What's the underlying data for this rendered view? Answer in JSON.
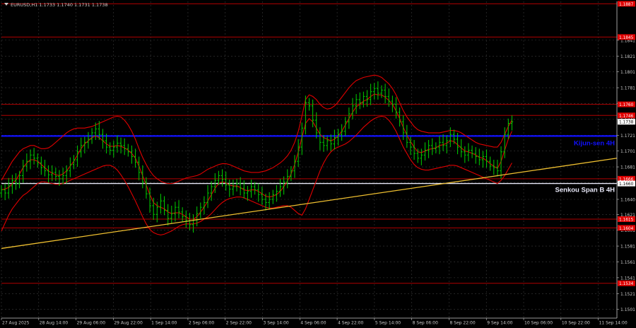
{
  "header": {
    "title": "EURUSD,H1  1.1733 1.1740 1.1731 1.1738"
  },
  "colors": {
    "background": "#000000",
    "grid": "#3a3a3a",
    "bull": "#00d000",
    "bear": "#00d000",
    "ichimoku": "#e00000",
    "kijun": "#1010ff",
    "senkou": "#e8e8f8",
    "level": "#b00000",
    "trend": "#f0c030",
    "axis_text": "#c8c8c8",
    "red_label_bg": "#e00000",
    "current_price_bg": "#ffffff"
  },
  "chart_data": {
    "type": "line",
    "symbol": "EURUSD",
    "timeframe": "H1",
    "ohlc_last": {
      "open": 1.1733,
      "high": 1.174,
      "low": 1.1731,
      "close": 1.1738
    },
    "ylim": [
      1.149,
      1.189
    ],
    "y_ticks": [
      "1.1841",
      "1.1821",
      "1.1801",
      "1.1781",
      "1.1761",
      "1.1741",
      "1.1721",
      "1.1701",
      "1.1681",
      "1.1661",
      "1.1640",
      "1.1621",
      "1.1601",
      "1.1581",
      "1.1561",
      "1.1541",
      "1.1521",
      "1.1501"
    ],
    "x_ticks": [
      "27 Aug 2025",
      "28 Aug 14:00",
      "29 Aug 06:00",
      "29 Aug 22:00",
      "1 Sep 14:00",
      "2 Sep 06:00",
      "2 Sep 22:00",
      "3 Sep 14:00",
      "4 Sep 06:00",
      "4 Sep 22:00",
      "5 Sep 14:00",
      "8 Sep 06:00",
      "8 Sep 22:00",
      "9 Sep 14:00",
      "10 Sep 06:00",
      "10 Sep 22:00",
      "11 Sep 14:00"
    ],
    "levels": [
      {
        "price": 1.1887,
        "label": "1.1887"
      },
      {
        "price": 1.1845,
        "label": "1.1845"
      },
      {
        "price": 1.176,
        "label": "1.1760"
      },
      {
        "price": 1.1746,
        "label": "1.1746"
      },
      {
        "price": 1.1666,
        "label": "1.1666"
      },
      {
        "price": 1.1615,
        "label": "1.1615"
      },
      {
        "price": 1.1604,
        "label": "1.1604"
      },
      {
        "price": 1.1534,
        "label": "1.1534"
      }
    ],
    "kijun_sen": {
      "price": 1.172,
      "label": "Kijun-sen 4H"
    },
    "senkou_span_b": {
      "price": 1.166,
      "label": "Senkou Span B 4H",
      "price_label": "1.1660"
    },
    "current_price": {
      "price": 1.1738,
      "label": "1.1738"
    },
    "trendline": {
      "start": [
        0,
        1.1578
      ],
      "end": [
        170,
        1.1692
      ]
    },
    "close": [
      1.1652,
      1.1648,
      1.1657,
      1.1664,
      1.166,
      1.167,
      1.1682,
      1.1688,
      1.1696,
      1.1692,
      1.1686,
      1.168,
      1.1676,
      1.1671,
      1.1674,
      1.1669,
      1.1666,
      1.167,
      1.1676,
      1.1684,
      1.169,
      1.17,
      1.1708,
      1.1712,
      1.1716,
      1.1724,
      1.1729,
      1.1722,
      1.1714,
      1.1706,
      1.1702,
      1.1706,
      1.1711,
      1.1708,
      1.1704,
      1.17,
      1.1694,
      1.1687,
      1.1674,
      1.1662,
      1.1647,
      1.1632,
      1.1621,
      1.163,
      1.1638,
      1.1626,
      1.1616,
      1.1622,
      1.163,
      1.1624,
      1.1618,
      1.1613,
      1.1608,
      1.1614,
      1.1622,
      1.163,
      1.1636,
      1.1648,
      1.1656,
      1.1664,
      1.167,
      1.1665,
      1.1658,
      1.1653,
      1.1656,
      1.166,
      1.1654,
      1.1648,
      1.165,
      1.1656,
      1.1652,
      1.1646,
      1.164,
      1.1636,
      1.164,
      1.1646,
      1.165,
      1.1656,
      1.1662,
      1.1669,
      1.1676,
      1.1688,
      1.1706,
      1.173,
      1.1762,
      1.1758,
      1.174,
      1.1724,
      1.1712,
      1.1708,
      1.1714,
      1.171,
      1.1718,
      1.1722,
      1.1726,
      1.1738,
      1.1748,
      1.1758,
      1.1766,
      1.1762,
      1.177,
      1.1766,
      1.1776,
      1.178,
      1.1774,
      1.1778,
      1.177,
      1.1764,
      1.176,
      1.175,
      1.1738,
      1.1724,
      1.1712,
      1.1706,
      1.1698,
      1.1692,
      1.1696,
      1.1702,
      1.1708,
      1.1704,
      1.1706,
      1.1712,
      1.1708,
      1.1714,
      1.1722,
      1.1716,
      1.1706,
      1.17,
      1.1696,
      1.1702,
      1.1698,
      1.1694,
      1.169,
      1.1694,
      1.1688,
      1.1682,
      1.168,
      1.1676,
      1.17,
      1.1722,
      1.1736,
      1.1738
    ],
    "tenkan": [
      1.1652,
      1.1653,
      1.1655,
      1.166,
      1.1664,
      1.1672,
      1.168,
      1.1686,
      1.169,
      1.169,
      1.1688,
      1.1684,
      1.168,
      1.1676,
      1.1673,
      1.1671,
      1.167,
      1.1672,
      1.1676,
      1.1682,
      1.1688,
      1.1696,
      1.1704,
      1.171,
      1.1714,
      1.1718,
      1.172,
      1.1718,
      1.1714,
      1.171,
      1.1707,
      1.1707,
      1.1708,
      1.1707,
      1.1705,
      1.1702,
      1.1698,
      1.1692,
      1.1682,
      1.167,
      1.1658,
      1.1646,
      1.1636,
      1.1632,
      1.163,
      1.1628,
      1.1624,
      1.1622,
      1.1623,
      1.1623,
      1.1621,
      1.1618,
      1.1615,
      1.1615,
      1.1618,
      1.1624,
      1.163,
      1.1638,
      1.1646,
      1.1654,
      1.166,
      1.1662,
      1.1661,
      1.1658,
      1.1657,
      1.1657,
      1.1655,
      1.1652,
      1.1651,
      1.1652,
      1.1652,
      1.165,
      1.1647,
      1.1644,
      1.1643,
      1.1644,
      1.1646,
      1.165,
      1.1656,
      1.1663,
      1.1672,
      1.1684,
      1.17,
      1.1718,
      1.1736,
      1.1742,
      1.1738,
      1.173,
      1.1722,
      1.1718,
      1.1716,
      1.1714,
      1.1716,
      1.172,
      1.1726,
      1.1734,
      1.1742,
      1.175,
      1.1757,
      1.176,
      1.1764,
      1.1766,
      1.177,
      1.1773,
      1.1772,
      1.1772,
      1.1769,
      1.1765,
      1.176,
      1.1752,
      1.1742,
      1.1731,
      1.1721,
      1.1713,
      1.1706,
      1.17,
      1.1699,
      1.1701,
      1.1703,
      1.1704,
      1.1705,
      1.1708,
      1.1709,
      1.1711,
      1.1714,
      1.1713,
      1.1709,
      1.1705,
      1.1701,
      1.17,
      1.1698,
      1.1696,
      1.1693,
      1.1692,
      1.1689,
      1.1685,
      1.1682,
      1.1679,
      1.1688,
      1.1702,
      1.1716,
      1.1726
    ],
    "bb_upper": [
      1.1664,
      1.1672,
      1.168,
      1.1688,
      1.1694,
      1.17,
      1.1704,
      1.1706,
      1.1708,
      1.1708,
      1.1706,
      1.1704,
      1.1704,
      1.1705,
      1.1708,
      1.1712,
      1.1716,
      1.172,
      1.1724,
      1.1727,
      1.1729,
      1.173,
      1.173,
      1.173,
      1.1731,
      1.1732,
      1.1734,
      1.1736,
      1.1738,
      1.174,
      1.1742,
      1.1744,
      1.1745,
      1.1744,
      1.174,
      1.1734,
      1.1726,
      1.1716,
      1.1704,
      1.1693,
      1.1684,
      1.1676,
      1.167,
      1.1666,
      1.1663,
      1.1661,
      1.166,
      1.166,
      1.1661,
      1.1663,
      1.1665,
      1.1667,
      1.1668,
      1.1669,
      1.167,
      1.1672,
      1.1675,
      1.1678,
      1.168,
      1.1682,
      1.1684,
      1.1685,
      1.1685,
      1.1684,
      1.1682,
      1.168,
      1.1678,
      1.1676,
      1.1675,
      1.1674,
      1.1674,
      1.1674,
      1.1675,
      1.1676,
      1.1678,
      1.168,
      1.1683,
      1.1686,
      1.169,
      1.1695,
      1.1702,
      1.1712,
      1.1726,
      1.1745,
      1.1766,
      1.1772,
      1.177,
      1.1766,
      1.176,
      1.1756,
      1.1754,
      1.1755,
      1.1758,
      1.1763,
      1.1769,
      1.1775,
      1.1781,
      1.1786,
      1.179,
      1.1792,
      1.1794,
      1.1795,
      1.1796,
      1.1797,
      1.1796,
      1.1794,
      1.179,
      1.1786,
      1.178,
      1.1772,
      1.1762,
      1.1752,
      1.1744,
      1.1738,
      1.1732,
      1.1728,
      1.1726,
      1.1725,
      1.1724,
      1.1724,
      1.1724,
      1.1724,
      1.1725,
      1.1726,
      1.1727,
      1.1727,
      1.1726,
      1.1724,
      1.1721,
      1.1718,
      1.1715,
      1.1712,
      1.171,
      1.1709,
      1.1708,
      1.1707,
      1.1706,
      1.1706,
      1.1712,
      1.1722,
      1.1732,
      1.174
    ],
    "bb_lower": [
      1.16,
      1.161,
      1.162,
      1.1628,
      1.1634,
      1.164,
      1.1645,
      1.1648,
      1.1652,
      1.1656,
      1.166,
      1.1662,
      1.1662,
      1.1661,
      1.166,
      1.1659,
      1.1659,
      1.166,
      1.1662,
      1.1664,
      1.1666,
      1.1668,
      1.167,
      1.1672,
      1.1674,
      1.1676,
      1.1678,
      1.168,
      1.1682,
      1.1683,
      1.1683,
      1.1681,
      1.1677,
      1.1671,
      1.1664,
      1.1656,
      1.1647,
      1.1638,
      1.1628,
      1.1618,
      1.1609,
      1.1602,
      1.1598,
      1.1596,
      1.1595,
      1.1596,
      1.1598,
      1.16,
      1.1603,
      1.1606,
      1.1608,
      1.1609,
      1.1609,
      1.1609,
      1.161,
      1.1612,
      1.1615,
      1.1618,
      1.1622,
      1.1627,
      1.1632,
      1.1636,
      1.1639,
      1.1641,
      1.1642,
      1.1643,
      1.1643,
      1.1642,
      1.164,
      1.1638,
      1.1636,
      1.1634,
      1.1632,
      1.163,
      1.1629,
      1.1629,
      1.163,
      1.1631,
      1.1632,
      1.1632,
      1.163,
      1.1626,
      1.1622,
      1.162,
      1.1628,
      1.164,
      1.1652,
      1.1664,
      1.1676,
      1.1686,
      1.1694,
      1.17,
      1.1704,
      1.1706,
      1.1708,
      1.171,
      1.1713,
      1.1717,
      1.1721,
      1.1726,
      1.1731,
      1.1735,
      1.1739,
      1.1742,
      1.1744,
      1.1745,
      1.1744,
      1.174,
      1.1734,
      1.1726,
      1.1716,
      1.1706,
      1.1698,
      1.169,
      1.1684,
      1.168,
      1.1678,
      1.1677,
      1.1677,
      1.1678,
      1.1679,
      1.168,
      1.1681,
      1.1682,
      1.1683,
      1.1683,
      1.1682,
      1.168,
      1.1678,
      1.1676,
      1.1674,
      1.1672,
      1.167,
      1.1668,
      1.1666,
      1.1664,
      1.1662,
      1.166,
      1.1664,
      1.167,
      1.1678,
      1.1686
    ]
  }
}
